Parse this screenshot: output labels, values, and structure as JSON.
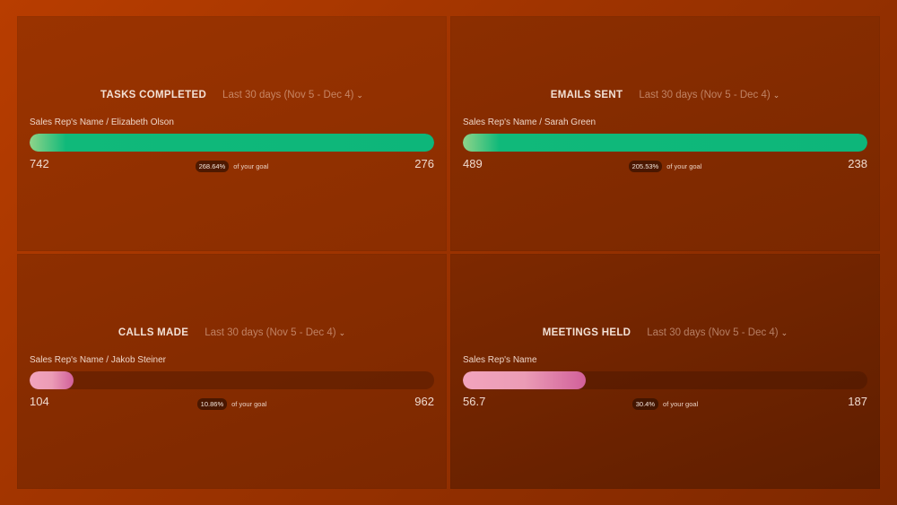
{
  "widgets": [
    {
      "title": "TASKS COMPLETED",
      "date_range": "Last 30 days (Nov 5 - Dec 4)",
      "rep_label": "Sales Rep's Name / Elizabeth Olson",
      "current_value": "742",
      "goal_value": "276",
      "percent_of_goal": "268.64%",
      "percent_suffix": "of your goal",
      "progress_fraction": 1.0,
      "bar_color": "#0db67a"
    },
    {
      "title": "EMAILS SENT",
      "date_range": "Last 30 days (Nov 5 - Dec 4)",
      "rep_label": "Sales Rep's Name / Sarah Green",
      "current_value": "489",
      "goal_value": "238",
      "percent_of_goal": "205.53%",
      "percent_suffix": "of your goal",
      "progress_fraction": 1.0,
      "bar_color": "#0db67a"
    },
    {
      "title": "CALLS MADE",
      "date_range": "Last 30 days (Nov 5 - Dec 4)",
      "rep_label": "Sales Rep's Name / Jakob Steiner",
      "current_value": "104",
      "goal_value": "962",
      "percent_of_goal": "10.86%",
      "percent_suffix": "of your goal",
      "progress_fraction": 0.1086,
      "bar_color": "#d1609a"
    },
    {
      "title": "MEETINGS HELD",
      "date_range": "Last 30 days (Nov 5 - Dec 4)",
      "rep_label": "Sales Rep's Name",
      "current_value": "56.7",
      "goal_value": "187",
      "percent_of_goal": "30.4%",
      "percent_suffix": "of your goal",
      "progress_fraction": 0.304,
      "bar_color": "#d1609a"
    }
  ],
  "icons": {
    "dropdown": "chevron-down-icon"
  }
}
